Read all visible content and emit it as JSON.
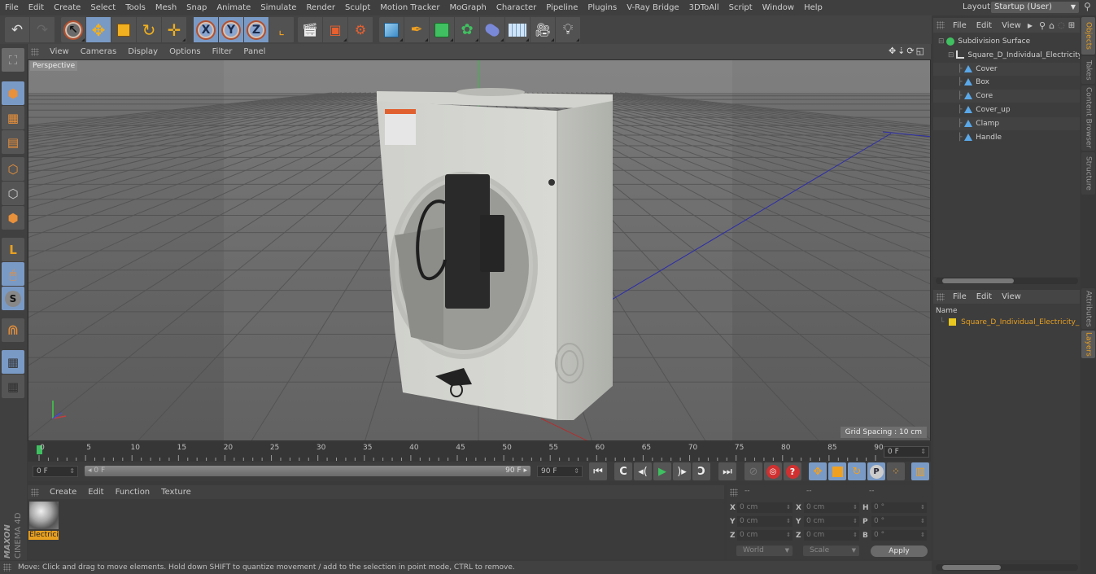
{
  "menubar": {
    "items": [
      "File",
      "Edit",
      "Create",
      "Select",
      "Tools",
      "Mesh",
      "Snap",
      "Animate",
      "Simulate",
      "Render",
      "Sculpt",
      "Motion Tracker",
      "MoGraph",
      "Character",
      "Pipeline",
      "Plugins",
      "V-Ray Bridge",
      "3DToAll",
      "Script",
      "Window",
      "Help"
    ],
    "layout_label": "Layout:",
    "layout_value": "Startup (User)"
  },
  "toolbar": {
    "undo_icon": "undo-icon",
    "redo_icon": "redo-icon",
    "tools": [
      {
        "name": "live-selection-tool",
        "glyph": "↖",
        "active": false
      },
      {
        "name": "move-tool",
        "glyph": "✥",
        "active": true
      },
      {
        "name": "scale-tool",
        "glyph": "◪",
        "active": false
      },
      {
        "name": "rotate-tool",
        "glyph": "↻",
        "active": false
      },
      {
        "name": "recent-tools",
        "glyph": "✛",
        "active": false
      }
    ],
    "axes": [
      "X",
      "Y",
      "Z"
    ],
    "coord_system_icon": "world-coordinate-icon",
    "render_buttons": [
      "render-view",
      "render-to-picture-viewer",
      "render-settings"
    ],
    "object_buttons": [
      "cube",
      "pen-spline",
      "subdivision-surface",
      "cloner",
      "deformer",
      "floor",
      "camera",
      "light"
    ]
  },
  "left_tools": [
    "make-editable",
    "model-mode",
    "texture-mode",
    "workplane-mode",
    "points-mode",
    "edges-mode",
    "polygons-mode",
    "axis-mode",
    "tweak-mode",
    "solo-mode",
    "snapping",
    "workplane-lock",
    "workplane-align"
  ],
  "viewport": {
    "menu": [
      "View",
      "Cameras",
      "Display",
      "Options",
      "Filter",
      "Panel"
    ],
    "camera_label": "Perspective",
    "grid_spacing": "Grid Spacing : 10 cm",
    "nav_icons": [
      "move-view-icon",
      "zoom-view-icon",
      "rotate-view-icon",
      "maximize-view-icon"
    ]
  },
  "timeline": {
    "ticks": [
      0,
      5,
      10,
      15,
      20,
      25,
      30,
      35,
      40,
      45,
      50,
      55,
      60,
      65,
      70,
      75,
      80,
      85,
      90
    ],
    "current_frame": 0,
    "max_frame": 90,
    "current_frame_field": "0 F"
  },
  "transport": {
    "start_field": "0 F",
    "range_start": "0 F",
    "range_end": "90 F",
    "end_field": "90 F",
    "buttons": [
      {
        "name": "go-to-start",
        "glyph": "⏮"
      },
      {
        "name": "previous-key",
        "glyph": "↶"
      },
      {
        "name": "previous-frame",
        "glyph": "◂"
      },
      {
        "name": "play-forward",
        "glyph": "▶"
      },
      {
        "name": "next-frame",
        "glyph": "▸"
      },
      {
        "name": "next-key",
        "glyph": "↷"
      },
      {
        "name": "go-to-end",
        "glyph": "⏭"
      }
    ],
    "key_buttons": [
      "record-active-objects",
      "autokeying",
      "keyframe-selection"
    ],
    "key_toggles": [
      "record-position",
      "record-scale",
      "record-rotation",
      "record-parameter",
      "record-point-level"
    ],
    "timeline_button": "timeline-window"
  },
  "material_manager": {
    "menu": [
      "Create",
      "Edit",
      "Function",
      "Texture"
    ],
    "materials": [
      {
        "name": "Electricity"
      }
    ],
    "material_label_visible": "Electrici"
  },
  "coordinates": {
    "headers": [
      "--",
      "--",
      "--"
    ],
    "position": {
      "X": "0 cm",
      "Y": "0 cm",
      "Z": "0 cm"
    },
    "size": {
      "X": "0 cm",
      "Y": "0 cm",
      "Z": "0 cm"
    },
    "rotation": {
      "H": "0 °",
      "P": "0 °",
      "B": "0 °"
    },
    "coord_mode": "World",
    "size_mode": "Scale",
    "apply_label": "Apply"
  },
  "status_bar": "Move: Click and drag to move elements. Hold down SHIFT to quantize movement / add to the selection in point mode, CTRL to remove.",
  "object_manager": {
    "menu": [
      "File",
      "Edit",
      "View"
    ],
    "tree": [
      {
        "label": "Subdivision Surface",
        "depth": 0,
        "type": "subdivision"
      },
      {
        "label": "Square_D_Individual_Electricity_Meter",
        "depth": 1,
        "type": "null"
      },
      {
        "label": "Cover",
        "depth": 2,
        "type": "polygon"
      },
      {
        "label": "Box",
        "depth": 2,
        "type": "polygon"
      },
      {
        "label": "Core",
        "depth": 2,
        "type": "polygon"
      },
      {
        "label": "Cover_up",
        "depth": 2,
        "type": "polygon"
      },
      {
        "label": "Clamp",
        "depth": 2,
        "type": "polygon"
      },
      {
        "label": "Handle",
        "depth": 2,
        "type": "polygon"
      }
    ]
  },
  "layer_manager": {
    "menu": [
      "File",
      "Edit",
      "View"
    ],
    "name_header": "Name",
    "layers": [
      {
        "label": "Square_D_Individual_Electricity_Meter",
        "color": "#e8c820"
      }
    ]
  },
  "side_tabs_top": [
    {
      "label": "Objects",
      "active": true
    },
    {
      "label": "Takes",
      "active": false
    },
    {
      "label": "Content Browser",
      "active": false
    },
    {
      "label": "Structure",
      "active": false
    }
  ],
  "side_tabs_bottom": [
    {
      "label": "Attributes",
      "active": false
    },
    {
      "label": "Layers",
      "active": true
    }
  ],
  "branding": {
    "maxon": "MAXON",
    "product": "CINEMA 4D"
  },
  "colors": {
    "accent_orange": "#e8a020",
    "active_blue": "#7a9ac6",
    "play_green": "#3ec060"
  }
}
